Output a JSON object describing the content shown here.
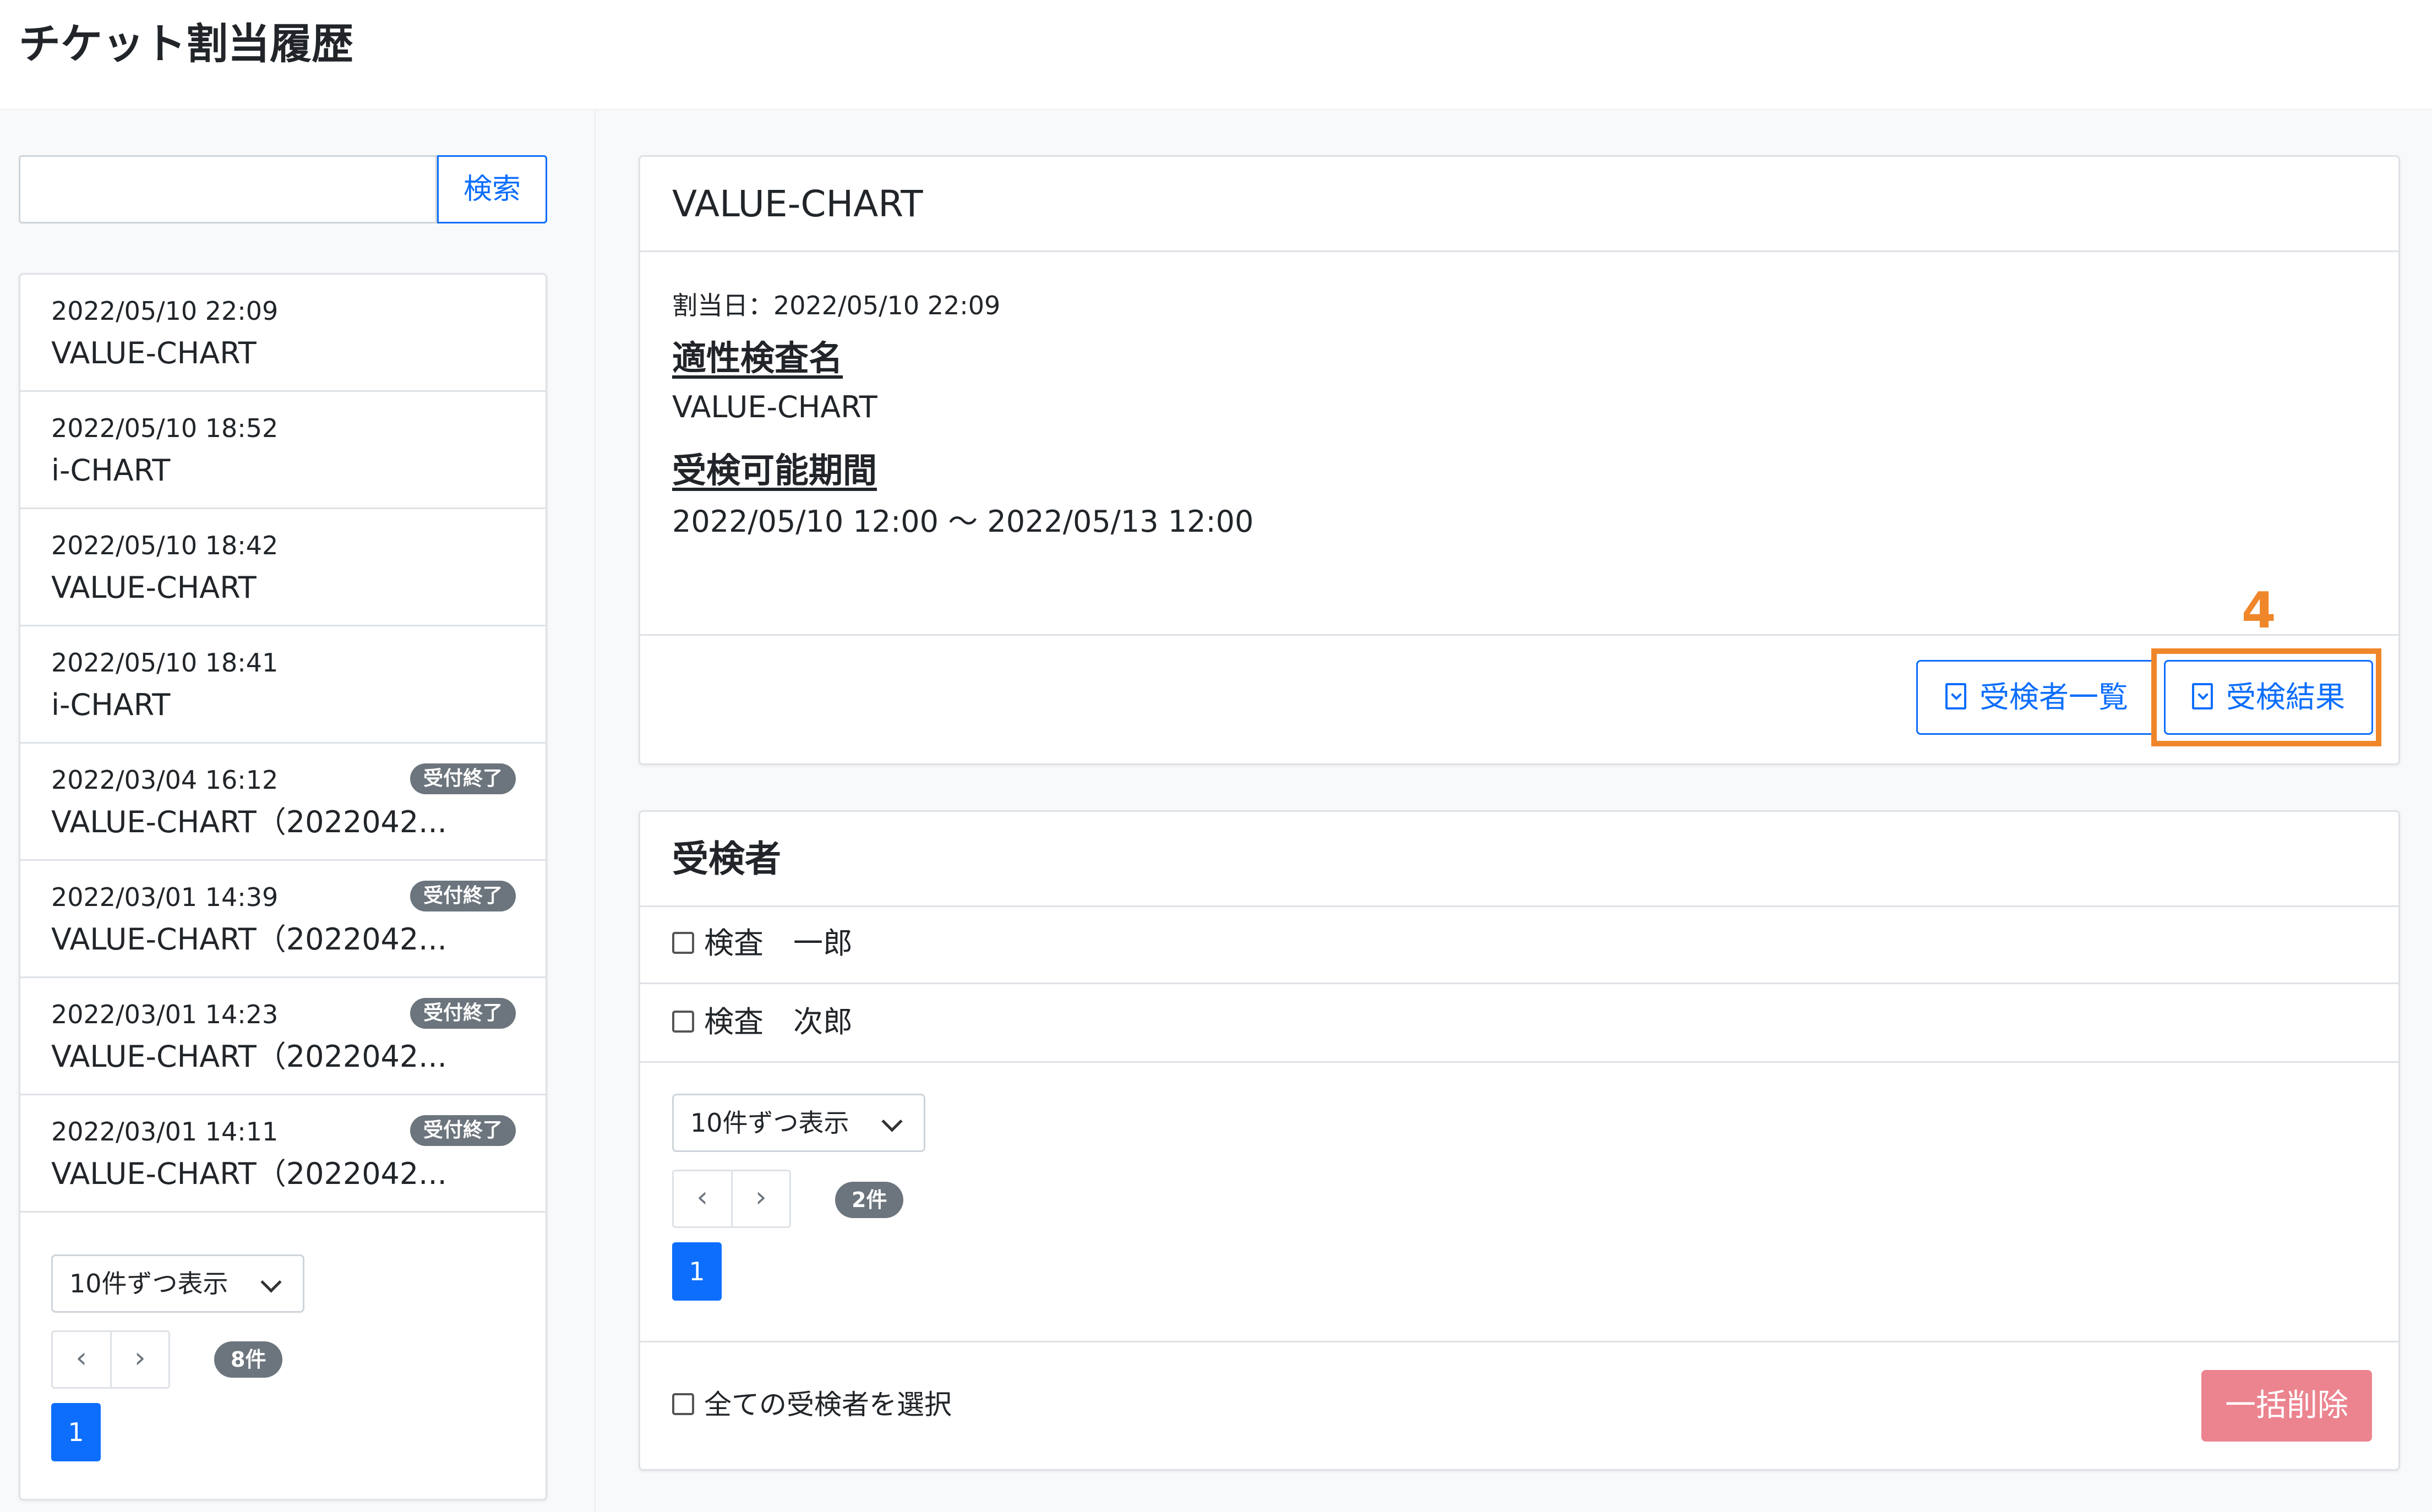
{
  "page": {
    "title": "チケット割当履歴"
  },
  "search": {
    "value": "",
    "placeholder": "",
    "button_label": "検索"
  },
  "history": {
    "items": [
      {
        "date": "2022/05/10 22:09",
        "name": "VALUE-CHART",
        "badge": ""
      },
      {
        "date": "2022/05/10 18:52",
        "name": "i-CHART",
        "badge": ""
      },
      {
        "date": "2022/05/10 18:42",
        "name": "VALUE-CHART",
        "badge": ""
      },
      {
        "date": "2022/05/10 18:41",
        "name": "i-CHART",
        "badge": ""
      },
      {
        "date": "2022/03/04 16:12",
        "name": "VALUE-CHART（2022042...",
        "badge": "受付終了"
      },
      {
        "date": "2022/03/01 14:39",
        "name": "VALUE-CHART（2022042...",
        "badge": "受付終了"
      },
      {
        "date": "2022/03/01 14:23",
        "name": "VALUE-CHART（2022042...",
        "badge": "受付終了"
      },
      {
        "date": "2022/03/01 14:11",
        "name": "VALUE-CHART（2022042...",
        "badge": "受付終了"
      }
    ],
    "per_page_selected": "10件ずつ表示",
    "prev_label": "‹",
    "next_label": "›",
    "count_badge": "8件",
    "current_page": "1"
  },
  "detail": {
    "title": "VALUE-CHART",
    "assign_date_text": "割当日：2022/05/10 22:09",
    "test_name_heading": "適性検査名",
    "test_name_value": "VALUE-CHART",
    "period_heading": "受検可能期間",
    "period_value": "2022/05/10 12:00 〜 2022/05/13 12:00",
    "examinee_list_button": "受検者一覧",
    "results_button": "受検結果",
    "step_number": "4",
    "highlight_color": "#f0862a"
  },
  "examinees": {
    "title": "受検者",
    "rows": [
      {
        "name": "検査　一郎"
      },
      {
        "name": "検査　次郎"
      }
    ],
    "per_page_selected": "10件ずつ表示",
    "prev_label": "‹",
    "next_label": "›",
    "count_badge": "2件",
    "current_page": "1",
    "select_all_label": "全ての受検者を選択",
    "bulk_delete_label": "一括削除"
  },
  "colors": {
    "primary": "#0d6efd",
    "secondary": "#6c757d",
    "danger_disabled": "#eb848f"
  }
}
